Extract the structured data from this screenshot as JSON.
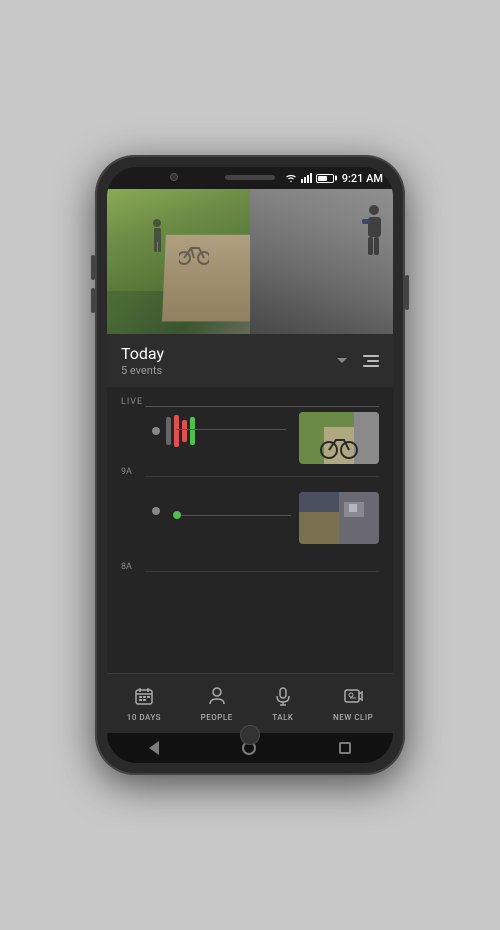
{
  "phone": {
    "status_bar": {
      "time": "9:21 AM"
    },
    "camera": {
      "alt": "Security camera fisheye view of front yard"
    },
    "today_header": {
      "title": "Today",
      "events_count": "5 events",
      "chevron_label": "collapse",
      "menu_label": "menu"
    },
    "timeline": {
      "live_label": "LIVE",
      "label_9a": "9A",
      "label_8a": "8A",
      "events": [
        {
          "type": "motion_with_bars",
          "thumbnail_alt": "Bike near yard"
        },
        {
          "type": "motion_dot",
          "thumbnail_alt": "Doorbell view"
        }
      ]
    },
    "bottom_nav": {
      "items": [
        {
          "label": "10 DAYS",
          "icon": "calendar-icon"
        },
        {
          "label": "PEOPLE",
          "icon": "person-icon"
        },
        {
          "label": "TALK",
          "icon": "mic-icon"
        },
        {
          "label": "NEW CLIP",
          "icon": "clip-icon"
        }
      ]
    },
    "android_nav": {
      "back": "back",
      "home": "home",
      "recent": "recent"
    }
  }
}
